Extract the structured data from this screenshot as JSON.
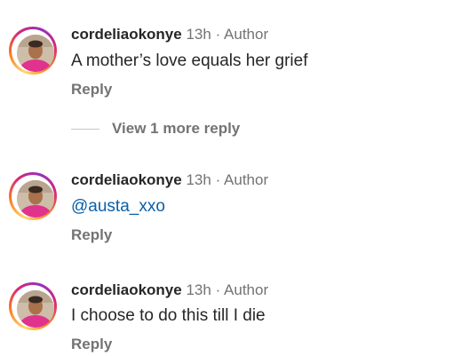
{
  "comments": [
    {
      "username": "cordeliaokonye",
      "time": "13h",
      "separator": "·",
      "badge": "Author",
      "text": "A mother’s love equals her grief",
      "reply_label": "Reply"
    },
    {
      "username": "cordeliaokonye",
      "time": "13h",
      "separator": "·",
      "badge": "Author",
      "text": "@austa_xxo",
      "reply_label": "Reply"
    },
    {
      "username": "cordeliaokonye",
      "time": "13h",
      "separator": "·",
      "badge": "Author",
      "text": "I choose to do this till I die",
      "reply_label": "Reply"
    }
  ],
  "view_more_replies": "View 1 more reply",
  "colors": {
    "mention": "#0a5fa8",
    "muted": "#737373",
    "text": "#262626",
    "story_ring": [
      "#feda75",
      "#fa7e1e",
      "#d62976",
      "#962fbf"
    ]
  },
  "icons": {
    "avatar": "user-avatar-photo"
  }
}
